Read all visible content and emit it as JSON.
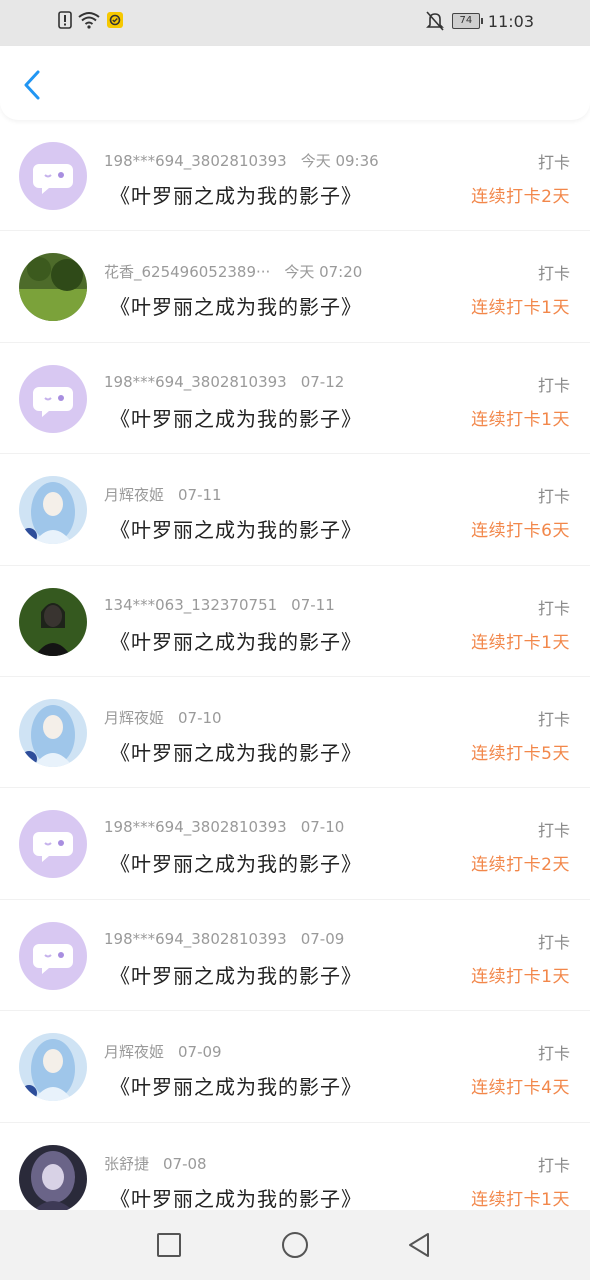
{
  "status_bar": {
    "battery": "74",
    "time": "11:03",
    "icons": [
      "alert-icon",
      "wifi-icon",
      "app-notification-icon",
      "bell-off-icon",
      "battery-icon"
    ]
  },
  "header": {
    "back_icon": "chevron-left-icon",
    "accent": "#2196f3"
  },
  "colors": {
    "streak": "#f2874a",
    "meta": "#9a9a9a",
    "title": "#222222"
  },
  "items": [
    {
      "avatar": "chat-bubble-avatar",
      "user": "198***694_3802810393",
      "time": "今天 09:36",
      "title": "《叶罗丽之成为我的影子》",
      "tag": "打卡",
      "streak": "连续打卡2天"
    },
    {
      "avatar": "nature-photo-avatar",
      "user": "花香_625496052389···",
      "time": "今天 07:20",
      "title": "《叶罗丽之成为我的影子》",
      "tag": "打卡",
      "streak": "连续打卡1天"
    },
    {
      "avatar": "chat-bubble-avatar",
      "user": "198***694_3802810393",
      "time": "07-12",
      "title": "《叶罗丽之成为我的影子》",
      "tag": "打卡",
      "streak": "连续打卡1天"
    },
    {
      "avatar": "anime-girl-avatar",
      "user": "月辉夜姬",
      "time": "07-11",
      "title": "《叶罗丽之成为我的影子》",
      "tag": "打卡",
      "streak": "连续打卡6天"
    },
    {
      "avatar": "portrait-photo-avatar",
      "user": "134***063_132370751",
      "time": "07-11",
      "title": "《叶罗丽之成为我的影子》",
      "tag": "打卡",
      "streak": "连续打卡1天"
    },
    {
      "avatar": "anime-girl-avatar",
      "user": "月辉夜姬",
      "time": "07-10",
      "title": "《叶罗丽之成为我的影子》",
      "tag": "打卡",
      "streak": "连续打卡5天"
    },
    {
      "avatar": "chat-bubble-avatar",
      "user": "198***694_3802810393",
      "time": "07-10",
      "title": "《叶罗丽之成为我的影子》",
      "tag": "打卡",
      "streak": "连续打卡2天"
    },
    {
      "avatar": "chat-bubble-avatar",
      "user": "198***694_3802810393",
      "time": "07-09",
      "title": "《叶罗丽之成为我的影子》",
      "tag": "打卡",
      "streak": "连续打卡1天"
    },
    {
      "avatar": "anime-girl-avatar",
      "user": "月辉夜姬",
      "time": "07-09",
      "title": "《叶罗丽之成为我的影子》",
      "tag": "打卡",
      "streak": "连续打卡4天"
    },
    {
      "avatar": "dark-anime-avatar",
      "user": "张舒捷",
      "time": "07-08",
      "title": "《叶罗丽之成为我的影子》",
      "tag": "打卡",
      "streak": "连续打卡1天"
    }
  ],
  "nav": {
    "icons": [
      "recent-apps-icon",
      "home-icon",
      "back-triangle-icon"
    ]
  }
}
